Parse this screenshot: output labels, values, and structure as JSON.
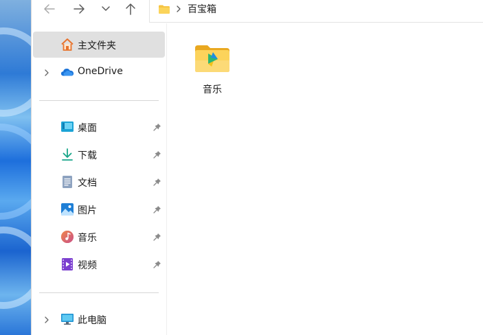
{
  "address": {
    "path": "百宝箱"
  },
  "sidebar": {
    "home": {
      "label": "主文件夹"
    },
    "onedrive": {
      "label": "OneDrive"
    },
    "pinned": [
      {
        "label": "桌面",
        "icon": "desktop-icon"
      },
      {
        "label": "下载",
        "icon": "download-icon"
      },
      {
        "label": "文档",
        "icon": "document-icon"
      },
      {
        "label": "图片",
        "icon": "pictures-icon"
      },
      {
        "label": "音乐",
        "icon": "music-icon"
      },
      {
        "label": "视频",
        "icon": "video-icon"
      }
    ],
    "thispc": {
      "label": "此电脑"
    }
  },
  "content": {
    "items": [
      {
        "label": "音乐",
        "icon": "music-folder-icon"
      }
    ]
  },
  "colors": {
    "selected_bg": "#e0e0e0",
    "folder_yellow": "#f8c63a",
    "onedrive_blue": "#1a73d8"
  }
}
